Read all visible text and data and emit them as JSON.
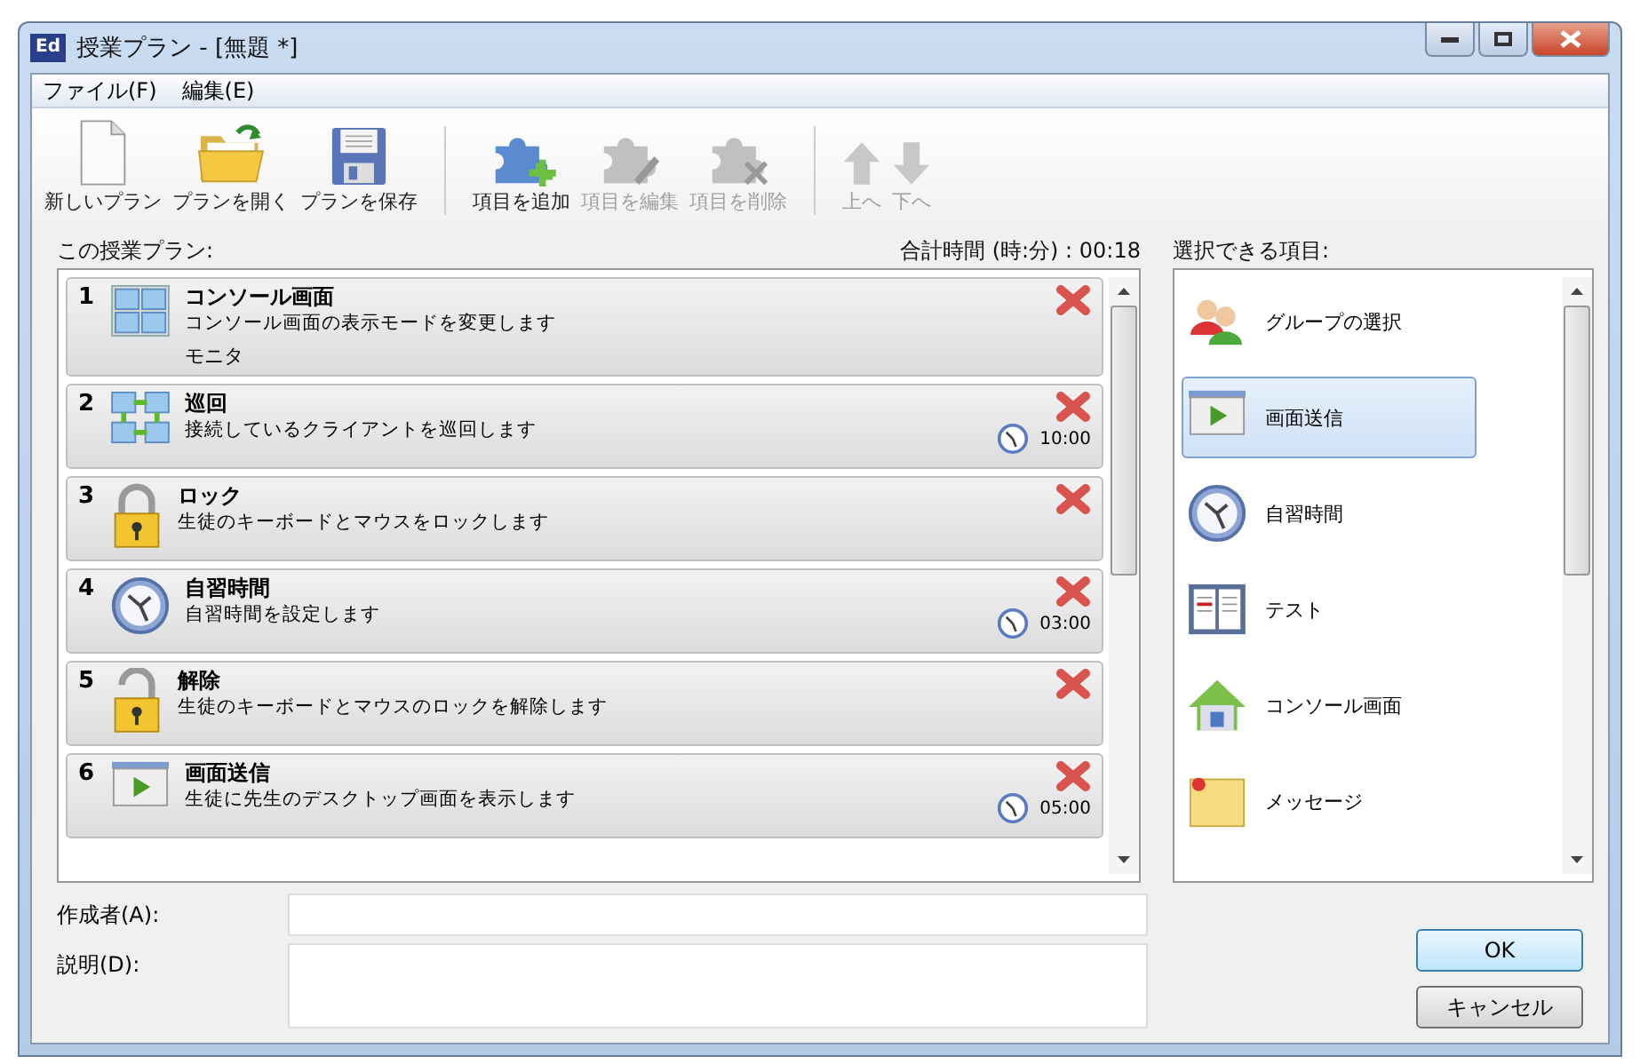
{
  "window": {
    "icon_label": "Ed",
    "title": "授業プラン - [無題 *]"
  },
  "menu": [
    "ファイル(F)",
    "編集(E)"
  ],
  "toolbar": [
    {
      "kind": "button",
      "label": "新しいプラン",
      "disabled": false
    },
    {
      "kind": "button",
      "label": "プランを開く",
      "disabled": false
    },
    {
      "kind": "button",
      "label": "プランを保存",
      "disabled": false
    },
    {
      "kind": "separator"
    },
    {
      "kind": "button",
      "label": "項目を追加",
      "disabled": false
    },
    {
      "kind": "button",
      "label": "項目を編集",
      "disabled": true
    },
    {
      "kind": "button",
      "label": "項目を削除",
      "disabled": true
    },
    {
      "kind": "separator"
    },
    {
      "kind": "button",
      "label": "上へ",
      "disabled": true
    },
    {
      "kind": "button",
      "label": "下へ",
      "disabled": true
    }
  ],
  "plan": {
    "label": "この授業プラン:",
    "total": "合計時間 (時:分) : 00:18",
    "items": [
      {
        "number": "1",
        "title": "コンソール画面",
        "description": "コンソール画面の表示モードを変更します",
        "detail": "モニタ"
      },
      {
        "number": "2",
        "title": "巡回",
        "description": "接続しているクライアントを巡回します",
        "time": "10:00"
      },
      {
        "number": "3",
        "title": "ロック",
        "description": "生徒のキーボードとマウスをロックします"
      },
      {
        "number": "4",
        "title": "自習時間",
        "description": "自習時間を設定します",
        "time": "03:00"
      },
      {
        "number": "5",
        "title": "解除",
        "description": "生徒のキーボードとマウスのロックを解除します"
      },
      {
        "number": "6",
        "title": "画面送信",
        "description": "生徒に先生のデスクトップ画面を表示します",
        "time": "05:00"
      }
    ]
  },
  "available": {
    "label": "選択できる項目:",
    "items": [
      {
        "label": "グループの選択",
        "selected": false
      },
      {
        "label": "画面送信",
        "selected": true
      },
      {
        "label": "自習時間",
        "selected": false
      },
      {
        "label": "テスト",
        "selected": false
      },
      {
        "label": "コンソール画面",
        "selected": false
      },
      {
        "label": "メッセージ",
        "selected": false
      }
    ]
  },
  "fields": [
    {
      "label": "作成者(A):",
      "kind": "line"
    },
    {
      "label": "説明(D):",
      "kind": "area"
    }
  ],
  "buttons": [
    {
      "label": "OK",
      "kind": "default"
    },
    {
      "label": "キャンセル",
      "kind": "normal"
    }
  ]
}
